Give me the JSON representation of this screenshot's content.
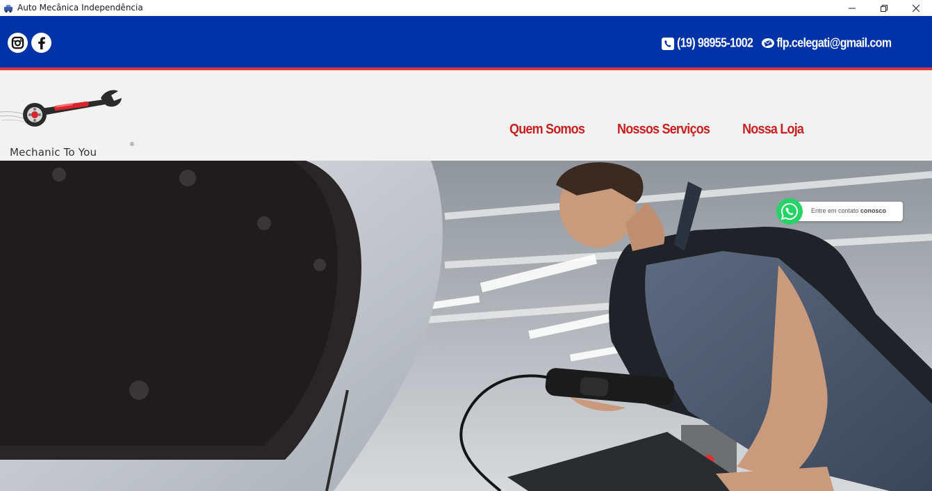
{
  "window": {
    "title": "Auto Mecânica Independência",
    "icon": "car-icon"
  },
  "topbar": {
    "social": [
      {
        "name": "instagram",
        "icon": "instagram-icon"
      },
      {
        "name": "facebook",
        "icon": "facebook-icon"
      }
    ],
    "phone": "(19) 98955-1002",
    "email": "flp.celegati@gmail.com",
    "colors": {
      "bar": "#0033a8",
      "accent_line": "#d9363e"
    }
  },
  "header": {
    "logo_text": "Mechanic To You",
    "logo_reg": "®",
    "nav": [
      "Quem Somos",
      "Nossos Serviços",
      "Nossa Loja"
    ],
    "nav_color": "#c8201f"
  },
  "hero": {
    "image": "mechanic-with-diagnostic-tool-photo"
  },
  "whatsapp": {
    "label_prefix": "Entre em contato ",
    "label_bold": "conosco",
    "color": "#25d366"
  }
}
